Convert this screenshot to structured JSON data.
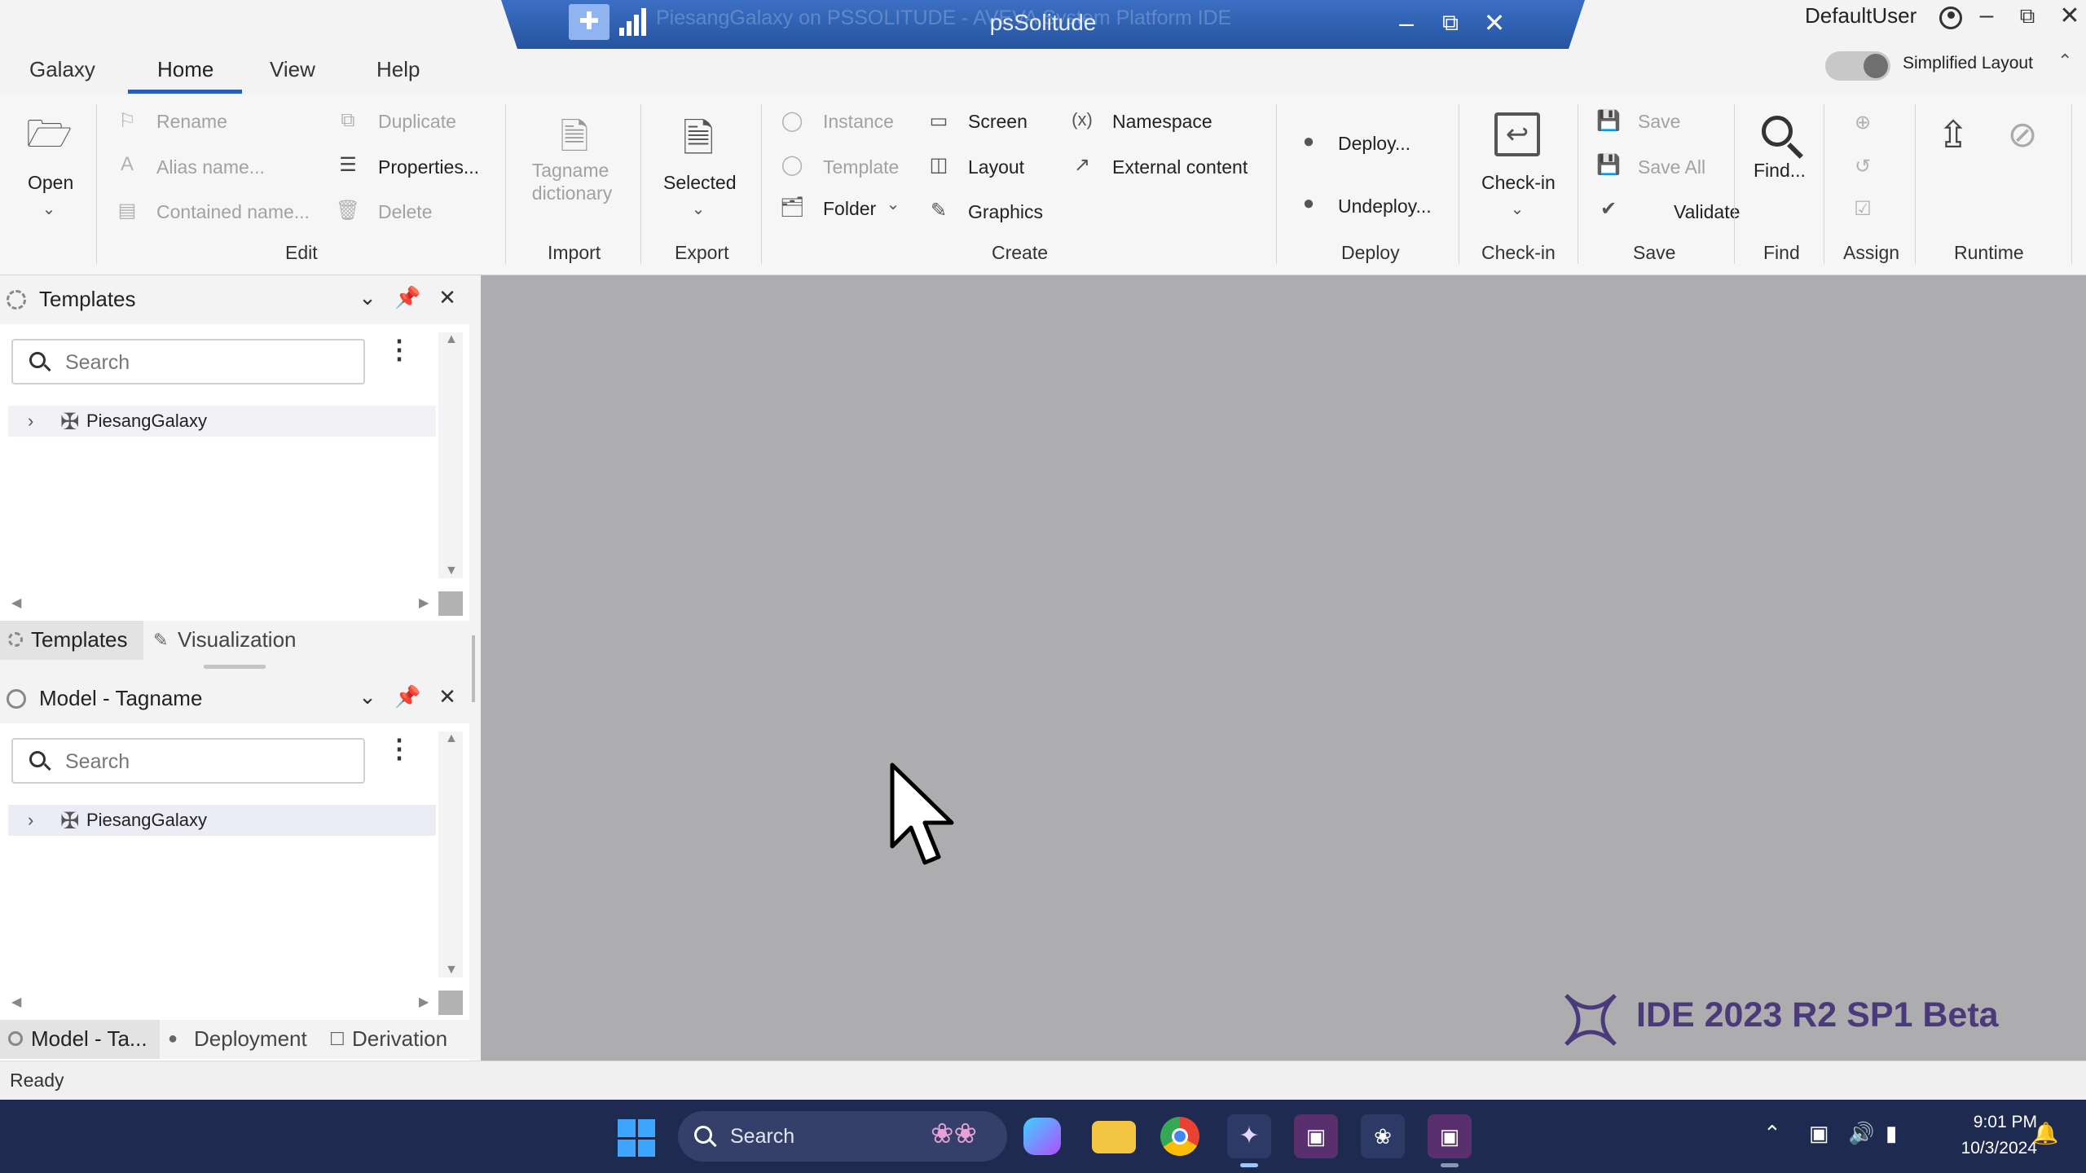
{
  "titlebar": {
    "ghost_title": "PiesangGalaxy on PSSOLITUDE - AVEVA System Platform IDE",
    "title": "psSolitude",
    "user": "DefaultUser"
  },
  "menu": {
    "tabs": [
      "Galaxy",
      "Home",
      "View",
      "Help"
    ],
    "active": "Home"
  },
  "layout_toggle": {
    "label": "Simplified Layout",
    "state": "off"
  },
  "ribbon": {
    "open": "Open",
    "edit": {
      "label": "Edit",
      "items": [
        "Rename",
        "Alias name...",
        "Contained name...",
        "Duplicate",
        "Properties...",
        "Delete"
      ]
    },
    "import": {
      "label": "Import",
      "items": [
        "Tagname",
        "dictionary"
      ]
    },
    "export": {
      "label": "Export",
      "items": [
        "Selected"
      ]
    },
    "create": {
      "label": "Create",
      "items": [
        "Instance",
        "Template",
        "Folder",
        "Screen",
        "Layout",
        "Graphics",
        "Namespace",
        "External content"
      ]
    },
    "deploy": {
      "label": "Deploy",
      "items": [
        "Deploy...",
        "Undeploy..."
      ]
    },
    "checkin": {
      "label": "Check-in",
      "items": [
        "Check-in"
      ]
    },
    "save": {
      "label": "Save",
      "items": [
        "Save",
        "Save All",
        "Validate"
      ]
    },
    "find": {
      "label": "Find",
      "items": [
        "Find..."
      ]
    },
    "assign": {
      "label": "Assign"
    },
    "runtime": {
      "label": "Runtime"
    }
  },
  "templates_panel": {
    "title": "Templates",
    "search_placeholder": "Search",
    "tree": [
      {
        "label": "PiesangGalaxy"
      }
    ],
    "tabs": [
      "Templates",
      "Visualization"
    ],
    "active_tab": "Templates"
  },
  "model_panel": {
    "title": "Model - Tagname",
    "search_placeholder": "Search",
    "tree": [
      {
        "label": "PiesangGalaxy"
      }
    ],
    "tabs": [
      "Model - Ta...",
      "Deployment",
      "Derivation"
    ],
    "active_tab": "Model - Ta..."
  },
  "canvas": {
    "version_text": "IDE 2023 R2 SP1 Beta",
    "background": "#adadb0"
  },
  "status": {
    "text": "Ready"
  },
  "taskbar": {
    "search_label": "Search",
    "time": "9:01 PM",
    "date": "10/3/2024",
    "apps": [
      "copilot-icon",
      "file-explorer-icon",
      "chrome-icon",
      "aveva-ide-icon",
      "aveva-app-icon",
      "aveva-app-icon",
      "aveva-app-icon"
    ]
  },
  "colors": {
    "title_accent": "#2f63b8",
    "taskbar": "#1f2a50",
    "brand_text": "#4a3a7a"
  }
}
